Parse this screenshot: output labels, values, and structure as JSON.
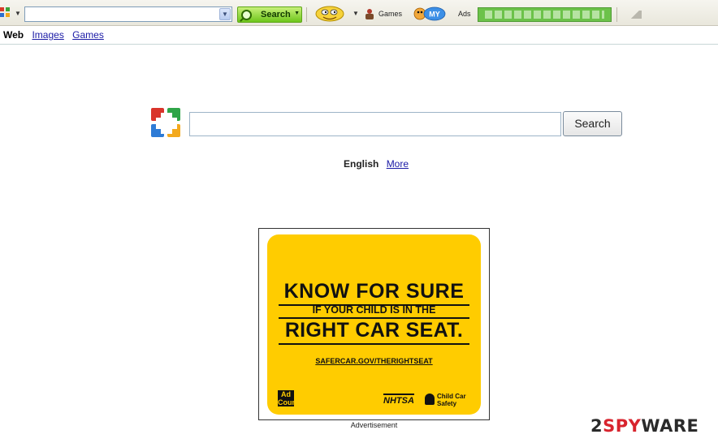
{
  "toolbar": {
    "search_button_label": "Search",
    "games_label": "Games",
    "my_label": "MY",
    "ads_label": "Ads",
    "search_value": ""
  },
  "nav": {
    "web": "Web",
    "images": "Images",
    "games": "Games"
  },
  "main": {
    "search_value": "",
    "search_button": "Search",
    "language": "English",
    "more": "More"
  },
  "ad": {
    "headline_1": "KNOW FOR SURE",
    "headline_2": "IF YOUR CHILD IS IN THE",
    "headline_3": "RIGHT CAR SEAT.",
    "url": "SAFERCAR.GOV/THERIGHTSEAT",
    "council": "Ad Council",
    "nhtsa": "NHTSA",
    "child_car_safety": "Child Car Safety",
    "caption": "Advertisement",
    "accent_color": "#ffcc00"
  },
  "watermark": {
    "prefix": "2",
    "spy": "SPY",
    "ware": "WARE"
  }
}
